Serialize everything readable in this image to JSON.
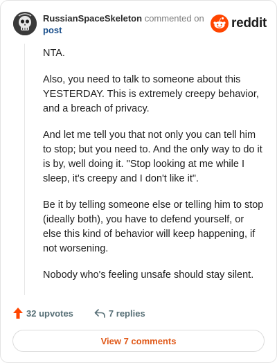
{
  "header": {
    "author": "RussianSpaceSkeleton",
    "action_text": "commented on",
    "post_link": "post",
    "logo_text": "reddit",
    "avatar_icon": "skeleton-avatar",
    "brand_color": "#ff4500"
  },
  "comment": {
    "paragraphs": [
      "NTA.",
      "Also, you need to talk to someone about this YESTERDAY. This is extremely creepy behavior, and a breach of privacy.",
      "And let me tell you that not only you can tell him to stop; but you need to. And the only way to do it is by, well doing it. \"Stop looking at me while I sleep, it's creepy and I don't like it\".",
      "Be it by telling someone else or telling him to stop (ideally both), you have to defend yourself, or else this kind of behavior will keep happening, if not worsening.",
      "Nobody who's feeling unsafe should stay silent."
    ]
  },
  "actions": {
    "upvotes": "32 upvotes",
    "replies": "7 replies",
    "upvote_icon": "upvote-arrow",
    "reply_icon": "reply-arrow",
    "upvote_color": "#ff4500"
  },
  "footer": {
    "view_comments": "View 7 comments",
    "accent_color": "#e05a1a"
  }
}
